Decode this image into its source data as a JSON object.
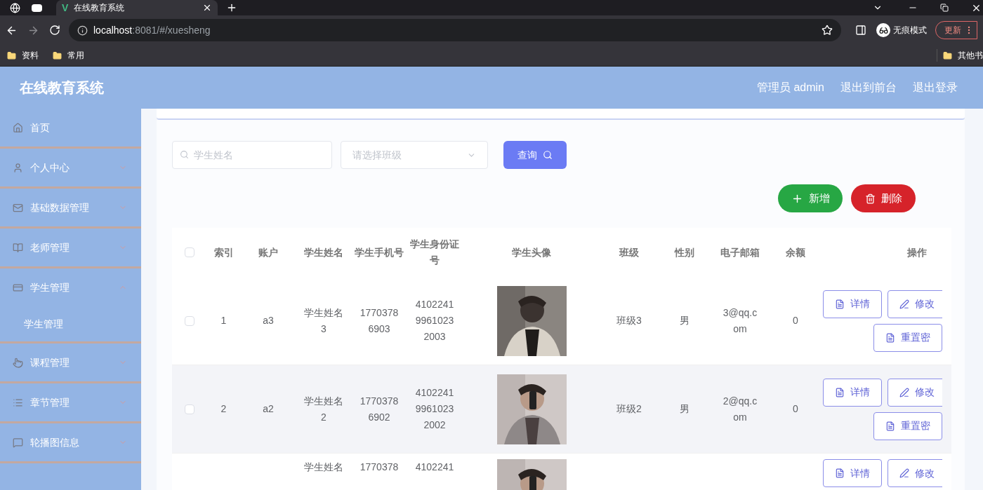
{
  "browser": {
    "tabs": [
      {
        "logo": "V",
        "title": "在线教育系统",
        "selected": true
      }
    ],
    "url_host": "localhost",
    "url_path": ":8081/#/xuesheng",
    "profile_label": "无痕模式",
    "update_label": "更新",
    "bookmarks": [
      "资料",
      "常用"
    ],
    "other_bookmarks": "其他书"
  },
  "header": {
    "title": "在线教育系统",
    "links": [
      "管理员 admin",
      "退出到前台",
      "退出登录"
    ]
  },
  "sidebar": {
    "items": [
      {
        "kind": "link",
        "label": "首页"
      },
      {
        "kind": "submenu",
        "label": "个人中心",
        "expanded": false
      },
      {
        "kind": "submenu",
        "label": "基础数据管理",
        "expanded": false
      },
      {
        "kind": "submenu",
        "label": "老师管理",
        "expanded": false
      },
      {
        "kind": "submenu",
        "label": "学生管理",
        "expanded": true,
        "children": [
          {
            "label": "学生管理"
          }
        ]
      },
      {
        "kind": "submenu",
        "label": "课程管理",
        "expanded": false
      },
      {
        "kind": "submenu",
        "label": "章节管理",
        "expanded": false
      },
      {
        "kind": "submenu",
        "label": "轮播图信息",
        "expanded": false
      }
    ]
  },
  "search": {
    "name_placeholder": "学生姓名",
    "class_placeholder": "请选择班级",
    "query_button": "查询"
  },
  "actions": {
    "add_button": "新增",
    "delete_button": "删除"
  },
  "table": {
    "all_checked": false,
    "columns": [
      "索引",
      "账户",
      "学生姓名",
      "学生手机号",
      "学生身份证号",
      "学生头像",
      "班级",
      "性别",
      "电子邮箱",
      "余额",
      "操作"
    ],
    "rows": [
      {
        "checked": false,
        "index": "1",
        "account": "a3",
        "name": "学生姓名3",
        "phone": "17703786903",
        "id_number": "410224199610232003",
        "avatar": {
          "kind": "picture"
        },
        "class": "班级3",
        "gender": "男",
        "email": "3@qq.com",
        "balance": "0",
        "buttons": [
          "详情",
          "修改",
          "重置密"
        ]
      },
      {
        "checked": false,
        "index": "2",
        "account": "a2",
        "name": "学生姓名2",
        "phone": "17703786902",
        "id_number": "410224199610232002",
        "avatar": {
          "kind": "picture"
        },
        "class": "班级2",
        "gender": "男",
        "email": "2@qq.com",
        "balance": "0",
        "buttons": [
          "详情",
          "修改",
          "重置密"
        ]
      },
      {
        "name": "学生姓名",
        "phone": "1770378",
        "id_number": "4102241",
        "avatar": {
          "kind": "picture"
        },
        "buttons": [
          "详情",
          "修改"
        ]
      }
    ]
  }
}
